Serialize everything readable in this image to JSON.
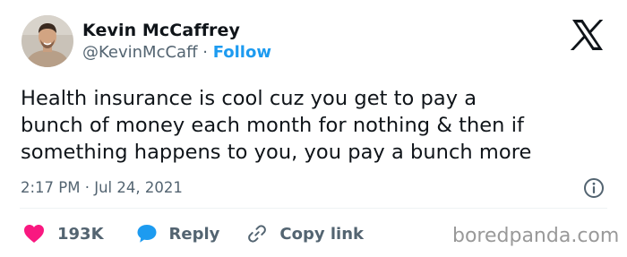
{
  "author": {
    "name": "Kevin McCaffrey",
    "handle": "@KevinMcCaff",
    "separator": "·",
    "follow_label": "Follow"
  },
  "tweet": {
    "text": "Health insurance is cool cuz you get to pay a\nbunch of money each month for nothing & then if\nsomething happens to you, you pay a bunch more",
    "timestamp": "2:17 PM · Jul 24, 2021"
  },
  "actions": {
    "likes_count": "193K",
    "reply_label": "Reply",
    "copy_link_label": "Copy link"
  },
  "watermark": "boredpanda.com",
  "icons": {
    "platform_logo": "x-logo-icon",
    "like": "heart-icon",
    "reply": "speech-bubble-icon",
    "copy": "link-icon",
    "info": "info-icon"
  },
  "colors": {
    "text": "#0f1419",
    "secondary": "#536471",
    "accent": "#1d9bf0",
    "like": "#f91880",
    "watermark": "#999999"
  }
}
